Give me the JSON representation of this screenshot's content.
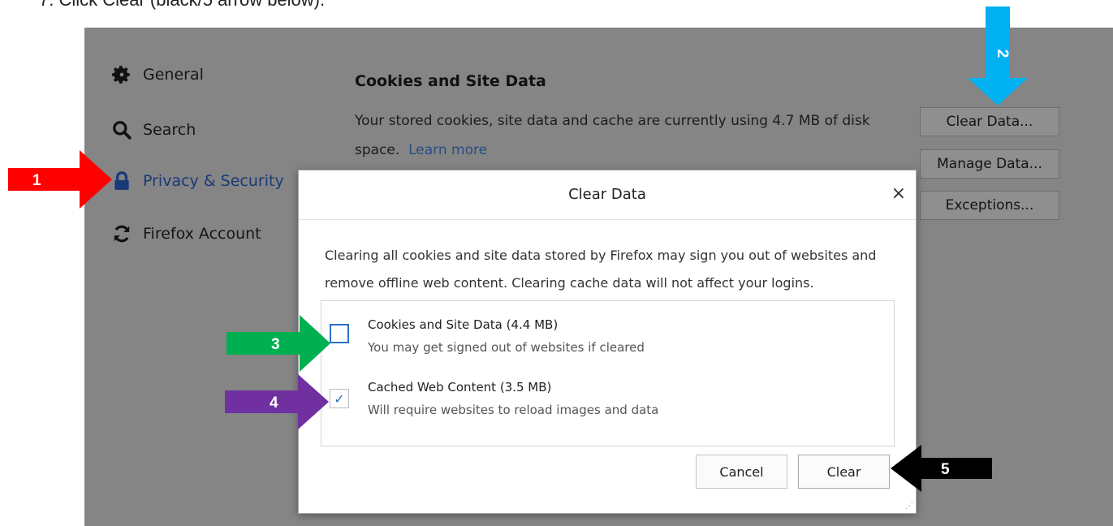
{
  "instruction": "7.   Click Clear (black/5 arrow below).",
  "sidebar": {
    "items": [
      {
        "label": "General",
        "icon": "gear-icon"
      },
      {
        "label": "Search",
        "icon": "search-icon"
      },
      {
        "label": "Privacy & Security",
        "icon": "lock-icon"
      },
      {
        "label": "Firefox Account",
        "icon": "sync-icon"
      }
    ]
  },
  "section": {
    "title": "Cookies and Site Data",
    "description": "Your stored cookies, site data and cache are currently using 4.7 MB of disk space.",
    "learn_more": "Learn more",
    "buttons": {
      "clear_data": "Clear Data...",
      "manage_data": "Manage Data...",
      "exceptions": "Exceptions..."
    }
  },
  "dialog": {
    "title": "Clear Data",
    "close": "×",
    "description": "Clearing all cookies and site data stored by Firefox may sign you out of websites and remove offline web content. Clearing cache data will not affect your logins.",
    "options": [
      {
        "label": "Cookies and Site Data (4.4 MB)",
        "sub": "You may get signed out of websites if cleared",
        "checked": false
      },
      {
        "label": "Cached Web Content (3.5 MB)",
        "sub": "Will require websites to reload images and data",
        "checked": true
      }
    ],
    "cancel_label": "Cancel",
    "clear_label": "Clear"
  },
  "annotations": [
    {
      "label": "1",
      "color": "#fe0000"
    },
    {
      "label": "2",
      "color": "#00b0f0"
    },
    {
      "label": "3",
      "color": "#00b050"
    },
    {
      "label": "4",
      "color": "#7030a0"
    },
    {
      "label": "5",
      "color": "#000000"
    }
  ],
  "colors": {
    "overlay_bg": "#858585",
    "link": "#2a4c85",
    "active_nav": "#193a78",
    "checkbox": "#2b70c4"
  }
}
